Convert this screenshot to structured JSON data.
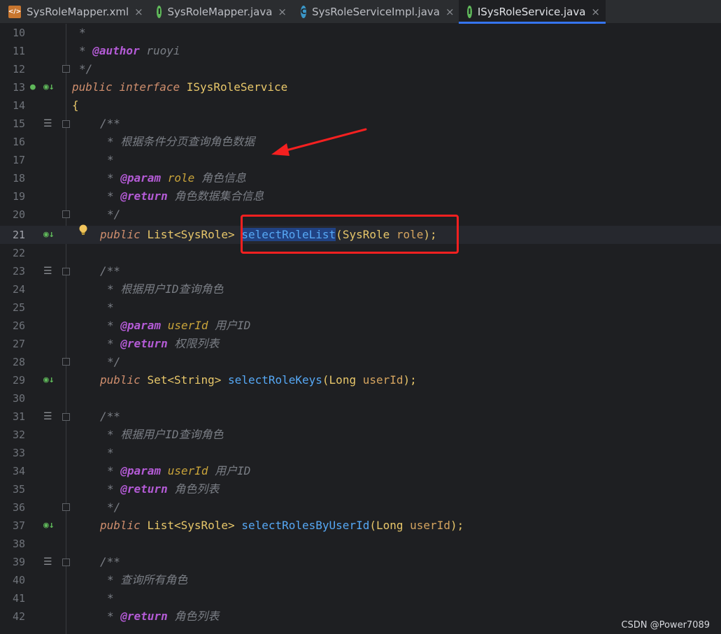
{
  "tabs": [
    {
      "label": "SysRoleMapper.xml",
      "icon": "xml-file-icon",
      "active": false
    },
    {
      "label": "SysRoleMapper.java",
      "icon": "interface-icon",
      "active": false
    },
    {
      "label": "SysRoleServiceImpl.java",
      "icon": "class-icon",
      "active": false
    },
    {
      "label": "ISysRoleService.java",
      "icon": "interface-icon",
      "active": true
    }
  ],
  "close_glyph": "×",
  "line_numbers": [
    "10",
    "11",
    "12",
    "13",
    "14",
    "15",
    "16",
    "17",
    "18",
    "19",
    "20",
    "21",
    "22",
    "23",
    "24",
    "25",
    "26",
    "27",
    "28",
    "29",
    "30",
    "31",
    "32",
    "33",
    "34",
    "35",
    "36",
    "37",
    "38",
    "39",
    "40",
    "41",
    "42"
  ],
  "code": {
    "l10": "*",
    "l11_star": "* ",
    "l11_tag": "@author",
    "l11_rest": " ruoyi",
    "l12": "*/",
    "l13_kw1": "public",
    "l13_kw2": "interface",
    "l13_name": "ISysRoleService",
    "l14": "{",
    "l15": "/**",
    "l16": "* 根据条件分页查询角色数据",
    "l17": "*",
    "l18_star": "* ",
    "l18_tag": "@param",
    "l18_p": "role",
    "l18_desc": " 角色信息",
    "l19_star": "* ",
    "l19_tag": "@return",
    "l19_desc": " 角色数据集合信息",
    "l20": "*/",
    "l21_kw": "public",
    "l21_type": "List<SysRole>",
    "l21_method": "selectRoleList",
    "l21_open": "(",
    "l21_ptype": "SysRole",
    "l21_p": "role",
    "l21_close": ");",
    "l23": "/**",
    "l24": "* 根据用户ID查询角色",
    "l25": "*",
    "l26_star": "* ",
    "l26_tag": "@param",
    "l26_p": "userId",
    "l26_desc": " 用户ID",
    "l27_star": "* ",
    "l27_tag": "@return",
    "l27_desc": " 权限列表",
    "l28": "*/",
    "l29_kw": "public",
    "l29_type": "Set<String>",
    "l29_method": "selectRoleKeys",
    "l29_open": "(",
    "l29_ptype": "Long",
    "l29_p": "userId",
    "l29_close": ");",
    "l31": "/**",
    "l32": "* 根据用户ID查询角色",
    "l33": "*",
    "l34_star": "* ",
    "l34_tag": "@param",
    "l34_p": "userId",
    "l34_desc": " 用户ID",
    "l35_star": "* ",
    "l35_tag": "@return",
    "l35_desc": " 角色列表",
    "l36": "*/",
    "l37_kw": "public",
    "l37_type": "List<SysRole>",
    "l37_method": "selectRolesByUserId",
    "l37_open": "(",
    "l37_ptype": "Long",
    "l37_p": "userId",
    "l37_close": ");",
    "l39": "/**",
    "l40": "* 查询所有角色",
    "l41": "*",
    "l42_star": "* ",
    "l42_tag": "@return",
    "l42_desc": " 角色列表"
  },
  "watermark": "CSDN @Power7089",
  "colors": {
    "annotation_red": "#f52020",
    "selection": "#214283",
    "active_tab_underline": "#3574f0"
  }
}
